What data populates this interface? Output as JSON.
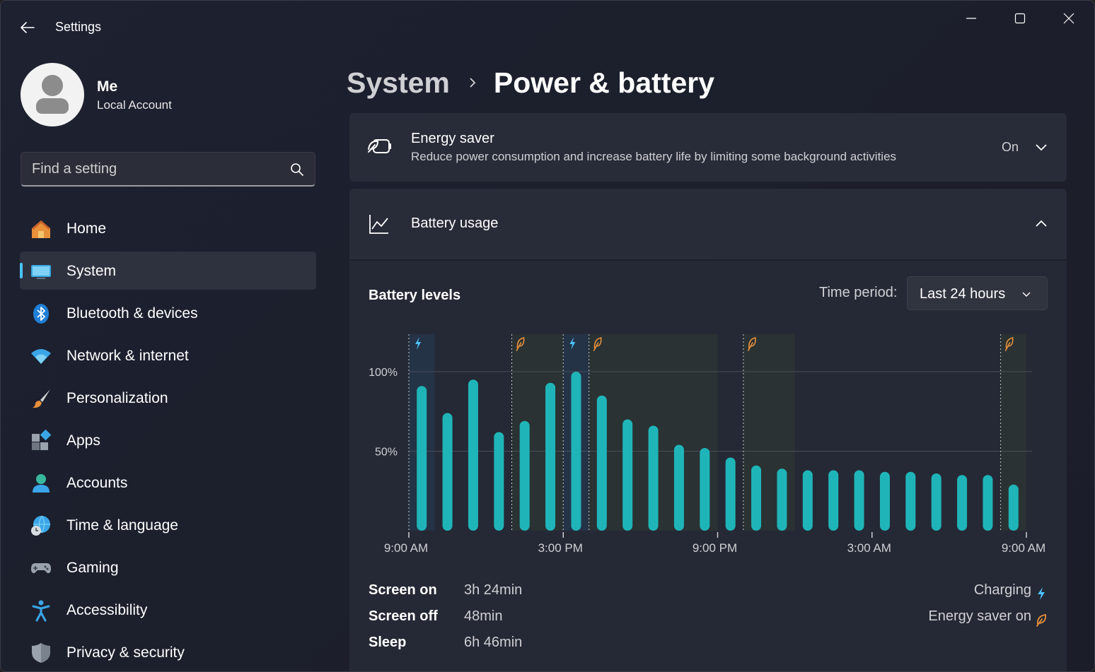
{
  "window": {
    "title": "Settings"
  },
  "profile": {
    "name": "Me",
    "account_type": "Local Account"
  },
  "search": {
    "placeholder": "Find a setting"
  },
  "sidebar": {
    "items": [
      {
        "label": "Home",
        "icon": "home-icon",
        "active": false
      },
      {
        "label": "System",
        "icon": "system-icon",
        "active": true
      },
      {
        "label": "Bluetooth & devices",
        "icon": "bluetooth-icon",
        "active": false
      },
      {
        "label": "Network & internet",
        "icon": "wifi-icon",
        "active": false
      },
      {
        "label": "Personalization",
        "icon": "paintbrush-icon",
        "active": false
      },
      {
        "label": "Apps",
        "icon": "apps-icon",
        "active": false
      },
      {
        "label": "Accounts",
        "icon": "accounts-icon",
        "active": false
      },
      {
        "label": "Time & language",
        "icon": "globe-clock-icon",
        "active": false
      },
      {
        "label": "Gaming",
        "icon": "gamepad-icon",
        "active": false
      },
      {
        "label": "Accessibility",
        "icon": "accessibility-icon",
        "active": false
      },
      {
        "label": "Privacy & security",
        "icon": "shield-icon",
        "active": false
      }
    ]
  },
  "breadcrumb": {
    "parent": "System",
    "current": "Power & battery"
  },
  "energy_saver": {
    "title": "Energy saver",
    "description": "Reduce power consumption and increase battery life by limiting some background activities",
    "state": "On"
  },
  "battery_usage": {
    "title": "Battery usage",
    "levels_title": "Battery levels",
    "period_label": "Time period:",
    "period_value": "Last 24 hours"
  },
  "stats": [
    {
      "label": "Screen on",
      "value": "3h 24min"
    },
    {
      "label": "Screen off",
      "value": "48min"
    },
    {
      "label": "Sleep",
      "value": "6h 46min"
    }
  ],
  "legend": {
    "charging": "Charging",
    "energy_saver": "Energy saver on"
  },
  "colors": {
    "accent": "#4cc2ff",
    "bar": "#1fb5b8",
    "charging": "#4cc2ff",
    "energy_saver": "#e8913a"
  },
  "chart_data": {
    "type": "bar",
    "ylabel": "",
    "ylim": [
      0,
      100
    ],
    "y_ticks": [
      "100%",
      "50%"
    ],
    "y_tick_values": [
      100,
      50
    ],
    "x_tick_labels": [
      "9:00 AM",
      "3:00 PM",
      "9:00 PM",
      "3:00 AM",
      "9:00 AM"
    ],
    "values": [
      91,
      74,
      95,
      62,
      69,
      93,
      100,
      85,
      70,
      66,
      54,
      52,
      46,
      41,
      39,
      38,
      38,
      38,
      37,
      37,
      36,
      35,
      35,
      29
    ],
    "charging_periods": [
      [
        0,
        1
      ],
      [
        6,
        7
      ]
    ],
    "energy_saver_periods": [
      [
        4,
        6
      ],
      [
        7,
        12
      ],
      [
        13,
        15
      ],
      [
        23,
        24
      ]
    ],
    "charging_markers": [
      0,
      6
    ],
    "energy_saver_markers": [
      4,
      7,
      13,
      23
    ]
  }
}
